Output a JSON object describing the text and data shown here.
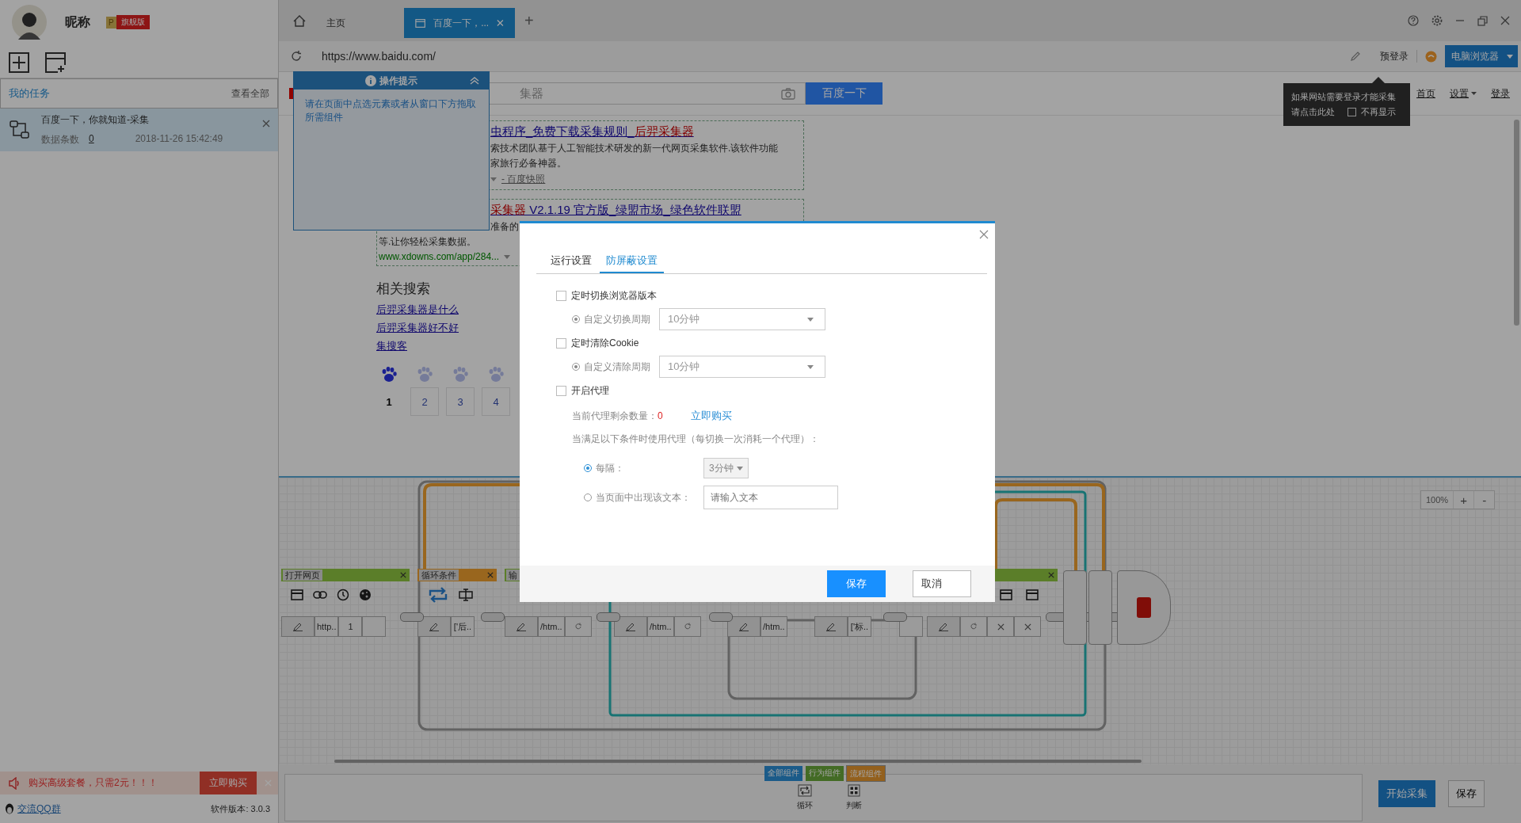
{
  "sidebar": {
    "user": {
      "nickname": "昵称",
      "level_mark": "P",
      "edition": "旗舰版"
    },
    "section_title": "我的任务",
    "view_all": "查看全部",
    "tasks": [
      {
        "name": "百度一下，你就知道-采集",
        "count_label": "数据条数",
        "count": "0",
        "time": "2018-11-26 15:42:49",
        "selected": true
      }
    ],
    "promo": {
      "text": "购买高级套餐，只需2元！！！",
      "button": "立即购买"
    },
    "qq_group": "交流QQ群",
    "version": "软件版本: 3.0.3"
  },
  "browser": {
    "tabs": [
      {
        "kind": "home",
        "label": "主页",
        "selected": false
      },
      {
        "kind": "page",
        "label": "百度一下，...",
        "selected": true
      }
    ],
    "new_tab": "+",
    "address": "https://www.baidu.com/",
    "pre_login": "预登录",
    "browser_mode": "电脑浏览器"
  },
  "tip_panel": {
    "title": "操作提示",
    "text": "请在页面中点选元素或者从窗口下方拖取所需组件"
  },
  "login_tooltip": {
    "lines": [
      "如果网站需要登录才能采集",
      "请点击此处"
    ],
    "dont_show": {
      "label": "不再显示",
      "checked": false
    }
  },
  "webpage": {
    "search_value": "集器",
    "search_button": "百度一下",
    "nav": [
      "首页",
      "设置",
      "登录"
    ],
    "results": [
      {
        "title": [
          {
            "text": "虫程序_免费下载采集规则_",
            "em": false
          },
          {
            "text": "后羿采集器",
            "em": true
          }
        ],
        "lines": [
          "索技术团队基于人工智能技术研发的新一代网页采集软件.该软件功能",
          "家旅行必备神器。"
        ],
        "snapshot": "- 百度快照"
      },
      {
        "title": [
          {
            "text": "采集器",
            "em": true
          },
          {
            "text": " V2.1.19 官方版_绿盟市场_绿色软件联盟",
            "em": false
          }
        ],
        "lines": [
          "准备的",
          "等.让你轻松采集数据。"
        ],
        "url": "www.xdowns.com/app/284..."
      }
    ],
    "related_title": "相关搜索",
    "related": [
      "后羿采集器是什么",
      "后羿采集器好不好",
      "集搜客"
    ],
    "pages": [
      {
        "label": "1",
        "selected": true
      },
      {
        "label": "2",
        "selected": false
      },
      {
        "label": "3",
        "selected": false
      },
      {
        "label": "4",
        "selected": false
      }
    ]
  },
  "workflow": {
    "nodes": [
      {
        "header": {
          "label": "打开网页",
          "kind": "action",
          "closable": true
        },
        "cells": [
          {
            "kind": "edit"
          },
          {
            "kind": "text",
            "text": "http.."
          },
          {
            "kind": "text",
            "text": "1"
          },
          {
            "kind": "blank"
          }
        ]
      },
      {
        "header": {
          "label": "循环条件",
          "kind": "loop",
          "closable": true
        },
        "cells": [
          {
            "kind": "edit"
          },
          {
            "kind": "text",
            "text": "['后.."
          }
        ]
      },
      {
        "header": {
          "label": "输",
          "kind": "action"
        },
        "cells": [
          {
            "kind": "edit"
          },
          {
            "kind": "text",
            "text": "/htm.."
          },
          {
            "kind": "refresh"
          }
        ]
      },
      {
        "cells": [
          {
            "kind": "edit"
          },
          {
            "kind": "text",
            "text": "/htm.."
          },
          {
            "kind": "refresh"
          }
        ]
      },
      {
        "cells": [
          {
            "kind": "edit"
          },
          {
            "kind": "text",
            "text": "/htm.."
          }
        ]
      },
      {
        "cells": [
          {
            "kind": "edit"
          },
          {
            "kind": "text",
            "text": "['标.."
          }
        ]
      },
      {
        "cells": [
          {
            "kind": "blank"
          }
        ]
      },
      {
        "header": {
          "kind": "action",
          "closable": true
        },
        "cells": [
          {
            "kind": "edit"
          },
          {
            "kind": "refresh"
          },
          {
            "kind": "close"
          },
          {
            "kind": "close"
          }
        ]
      }
    ]
  },
  "zoom": {
    "level_text": "100%",
    "plus": "+",
    "minus": "-"
  },
  "component_tabs": [
    {
      "label": "全部组件",
      "kind": "all",
      "selected": false
    },
    {
      "label": "行为组件",
      "kind": "action",
      "selected": false
    },
    {
      "label": "流程组件",
      "kind": "flow",
      "selected": true
    }
  ],
  "components": [
    {
      "kind": "loop",
      "label": "循环"
    },
    {
      "kind": "judge",
      "label": "判断"
    }
  ],
  "start_button": "开始采集",
  "save_button": "保存",
  "dialog": {
    "tabs": [
      {
        "label": "运行设置",
        "selected": false
      },
      {
        "label": "防屏蔽设置",
        "selected": true
      }
    ],
    "options": [
      {
        "kind": "check",
        "label": "定时切换浏览器版本",
        "checked": false
      },
      {
        "kind": "period",
        "label": "自定义切换周期",
        "selected": true,
        "disabled": true,
        "value": "10分钟"
      },
      {
        "kind": "check",
        "label": "定时清除Cookie",
        "checked": false
      },
      {
        "kind": "period",
        "label": "自定义清除周期",
        "selected": true,
        "disabled": true,
        "value": "10分钟"
      },
      {
        "kind": "check",
        "label": "开启代理",
        "checked": false
      },
      {
        "kind": "quota",
        "label": "当前代理剩余数量：",
        "count": "0",
        "link": "立即购买"
      },
      {
        "kind": "note",
        "label": "当满足以下条件时使用代理（每切换一次消耗一个代理）："
      },
      {
        "kind": "interval",
        "label": "每隔：",
        "selected": true,
        "value": "3分钟"
      },
      {
        "kind": "text_match",
        "label": "当页面中出现该文本：",
        "selected": false,
        "placeholder": "请输入文本"
      }
    ],
    "buttons": [
      {
        "kind": "primary",
        "label": "保存"
      },
      {
        "kind": "secondary",
        "label": "取消"
      }
    ]
  }
}
